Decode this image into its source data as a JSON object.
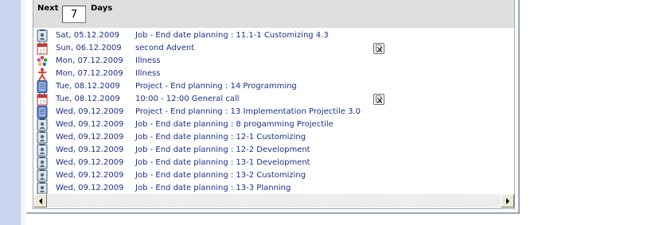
{
  "toolbar": {
    "next_label": "Next",
    "days_value": "7",
    "days_label": "Days"
  },
  "entries": [
    {
      "icon": "job-icon",
      "date": "Sat, 05.12.2009",
      "text": "Job - End date planning : 11.1-1 Customizing 4.3",
      "deletable": false
    },
    {
      "icon": "calendar-icon",
      "date": "Sun, 06.12.2009",
      "text": "second Advent",
      "deletable": true
    },
    {
      "icon": "illness-icon",
      "date": "Mon, 07.12.2009",
      "text": "Illness",
      "deletable": false
    },
    {
      "icon": "person-icon",
      "date": "Mon, 07.12.2009",
      "text": "Illness",
      "deletable": false
    },
    {
      "icon": "project-icon",
      "date": "Tue, 08.12.2009",
      "text": "Project - End planning : 14 Programming",
      "deletable": false
    },
    {
      "icon": "calendar-icon",
      "date": "Tue, 08.12.2009",
      "text": "10:00 - 12:00 General call",
      "deletable": true
    },
    {
      "icon": "project-icon",
      "date": "Wed, 09.12.2009",
      "text": "Project - End planning : 13 Implementation Projectile 3.0",
      "deletable": false
    },
    {
      "icon": "job-icon",
      "date": "Wed, 09.12.2009",
      "text": "Job - End date planning : 8 progamming Projectile",
      "deletable": false
    },
    {
      "icon": "job-icon",
      "date": "Wed, 09.12.2009",
      "text": "Job - End date planning : 12-1 Customizing",
      "deletable": false
    },
    {
      "icon": "job-icon",
      "date": "Wed, 09.12.2009",
      "text": "Job - End date planning : 12-2 Development",
      "deletable": false
    },
    {
      "icon": "job-icon",
      "date": "Wed, 09.12.2009",
      "text": "Job - End date planning : 13-1 Development",
      "deletable": false
    },
    {
      "icon": "job-icon",
      "date": "Wed, 09.12.2009",
      "text": "Job - End date planning : 13-2 Customizing",
      "deletable": false
    },
    {
      "icon": "job-icon",
      "date": "Wed, 09.12.2009",
      "text": "Job - End date planning : 13-3 Planning",
      "deletable": false
    }
  ],
  "colors": {
    "link_text": "#1c2f8a",
    "toolbar_bg": "#dedede"
  }
}
